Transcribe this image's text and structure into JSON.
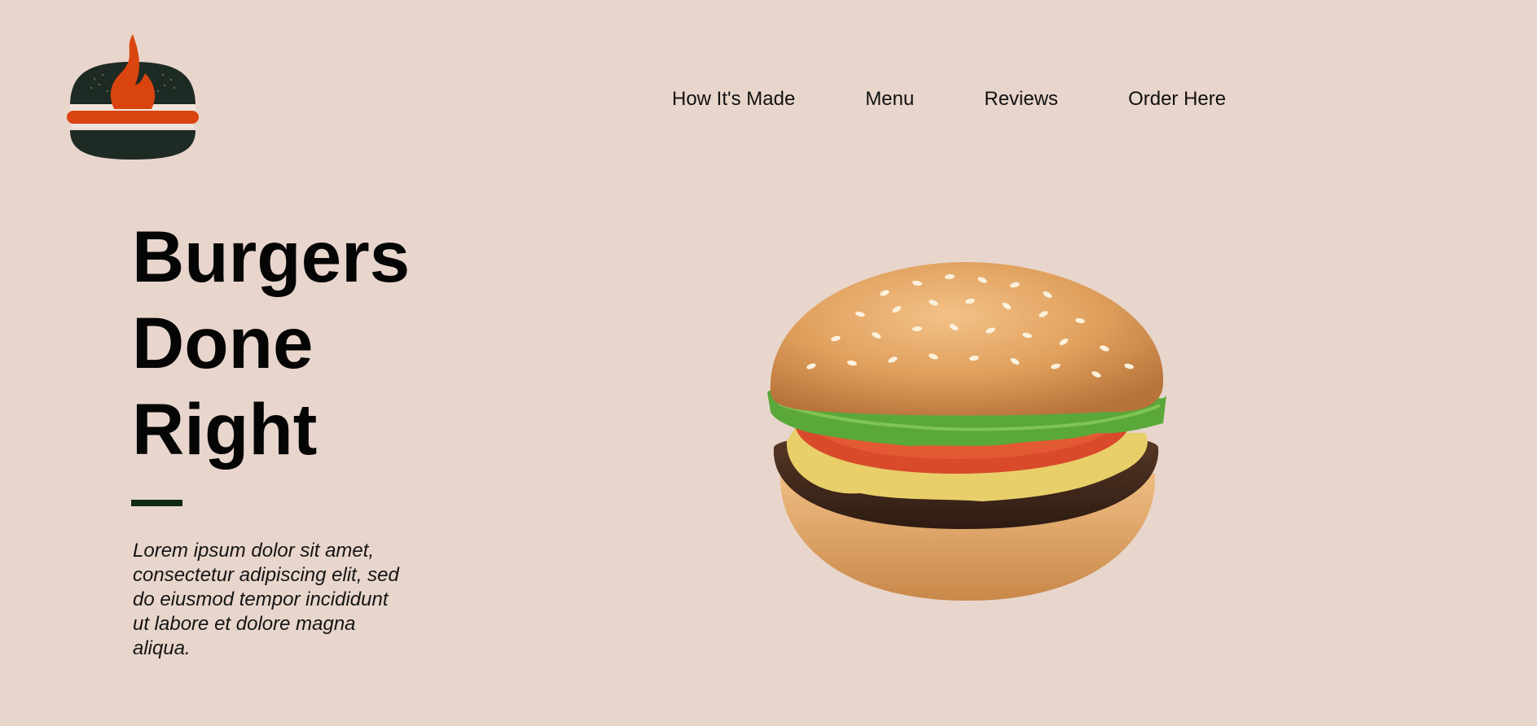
{
  "brand": {
    "logo_icon": "flame-burger-logo-icon",
    "colors": {
      "bun": "#1e2a24",
      "flame": "#d9440f",
      "background": "#e8d6cc",
      "accent_bar": "#0f2a14"
    }
  },
  "nav": {
    "items": [
      {
        "label": "How It's Made"
      },
      {
        "label": "Menu"
      },
      {
        "label": "Reviews"
      },
      {
        "label": "Order Here"
      }
    ]
  },
  "hero": {
    "title_lines": [
      "Burgers",
      "Done",
      "Right"
    ],
    "description": "Lorem ipsum dolor sit amet, consectetur adipiscing elit, sed do eiusmod tempor incididunt ut labore et dolore magna aliqua.",
    "image_icon": "burger-photo"
  }
}
